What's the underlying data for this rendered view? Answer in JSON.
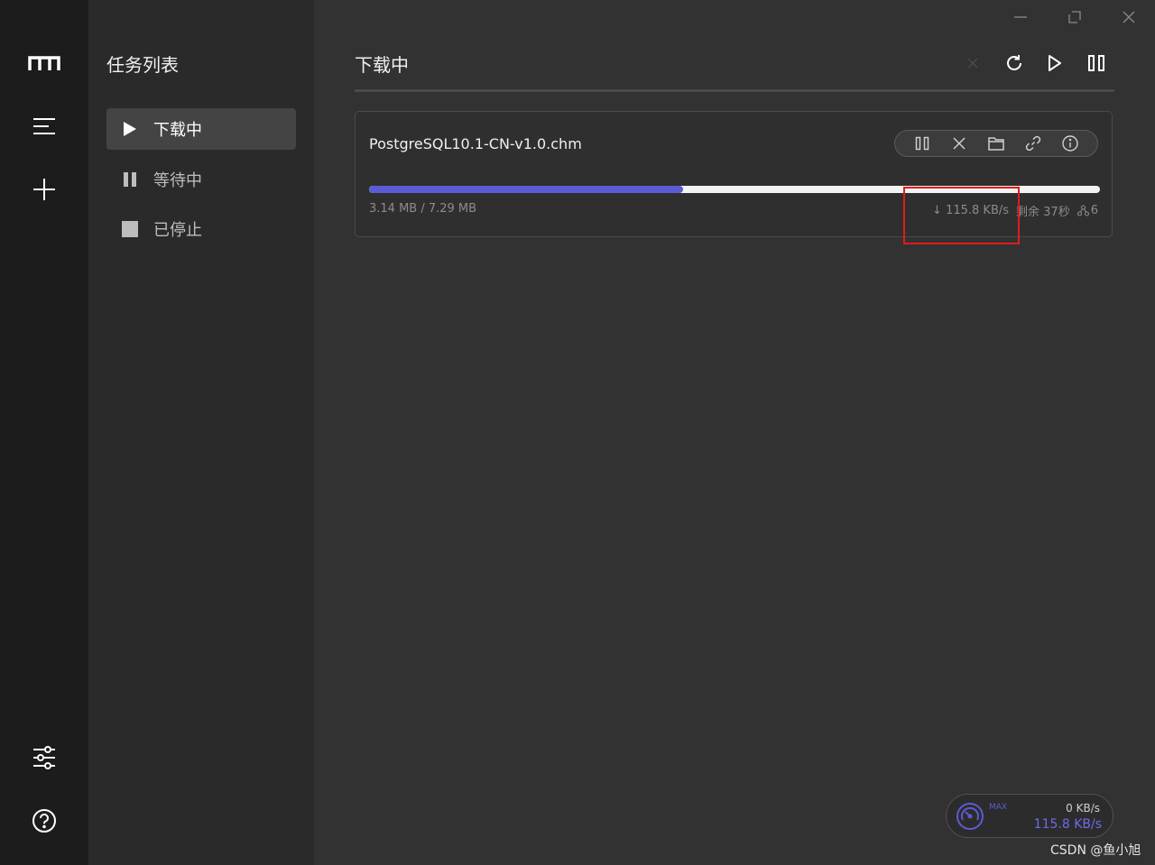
{
  "rail": {
    "icons": [
      "logo-icon",
      "menu-icon",
      "add-icon",
      "preferences-icon",
      "help-icon"
    ]
  },
  "sidebar": {
    "title": "任务列表",
    "items": [
      {
        "label": "下载中",
        "icon": "play-icon",
        "active": true
      },
      {
        "label": "等待中",
        "icon": "pause-icon",
        "active": false
      },
      {
        "label": "已停止",
        "icon": "stop-icon",
        "active": false
      }
    ]
  },
  "header": {
    "title": "下载中",
    "toolbar": [
      "delete-icon",
      "refresh-icon",
      "resume-all-icon",
      "pause-all-icon"
    ]
  },
  "task": {
    "name": "PostgreSQL10.1-CN-v1.0.chm",
    "size": "3.14 MB / 7.29 MB",
    "progress": 0.43,
    "speed": "↓ 115.8 KB/s",
    "remaining": "剩余 37秒",
    "connections": "6",
    "actions": [
      "pause-icon",
      "delete-icon",
      "folder-icon",
      "link-icon",
      "info-icon"
    ]
  },
  "speedometer": {
    "max_label": "MAX",
    "upload": "0 KB/s",
    "download": "115.8 KB/s"
  },
  "watermark": "CSDN @鱼小旭",
  "colors": {
    "accent": "#5b5bd6",
    "highlight": "#e21b1b",
    "rail_bg": "#1c1c1c",
    "sidebar_bg": "#2a2a2a",
    "main_bg": "#323232"
  }
}
